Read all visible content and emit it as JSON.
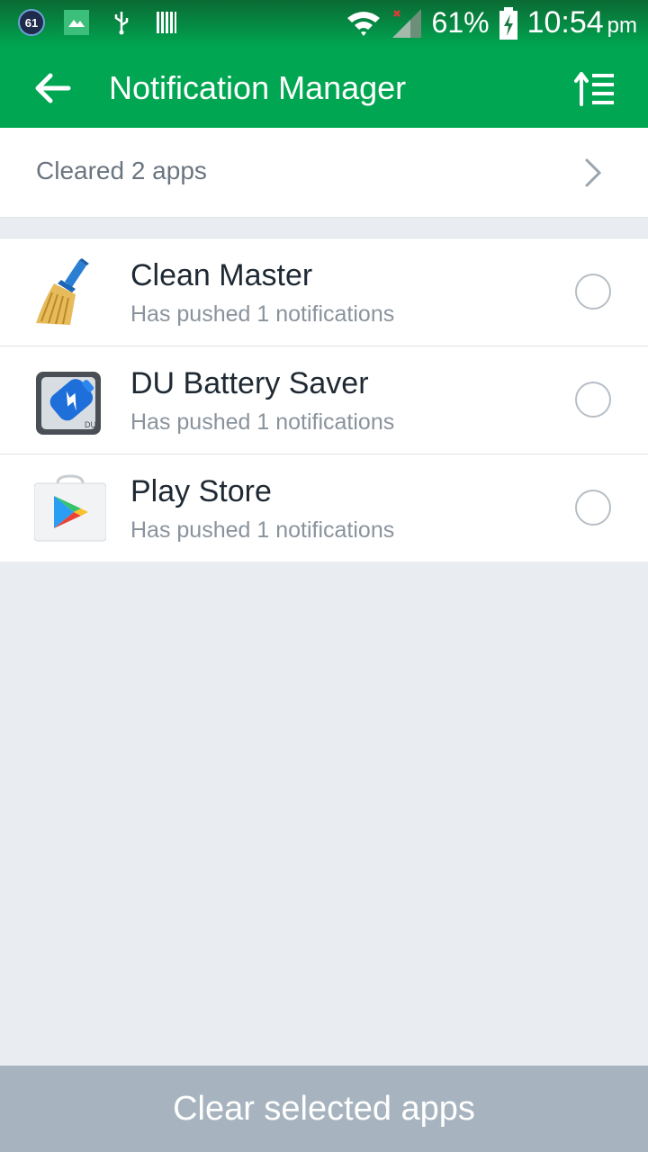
{
  "status_bar": {
    "notification_badge": "61",
    "battery_percent": "61%",
    "time": "10:54",
    "ampm": "pm",
    "icons": [
      "badge-icon",
      "photo-icon",
      "usb-icon",
      "barcode-icon",
      "wifi-icon",
      "signal-icon",
      "battery-charging-icon"
    ]
  },
  "app_bar": {
    "title": "Notification Manager",
    "back_icon": "arrow-left-icon",
    "sort_icon": "sort-list-icon",
    "color": "#00a651"
  },
  "cleared": {
    "label": "Cleared 2 apps",
    "icon": "chevron-right-icon"
  },
  "apps": [
    {
      "name": "Clean Master",
      "subtitle": "Has pushed 1 notifications",
      "icon": "broom-icon",
      "selected": false
    },
    {
      "name": "DU Battery Saver",
      "subtitle": "Has pushed 1 notifications",
      "icon": "battery-icon",
      "selected": false
    },
    {
      "name": "Play Store",
      "subtitle": "Has pushed 1 notifications",
      "icon": "play-store-icon",
      "selected": false
    }
  ],
  "footer": {
    "button_label": "Clear selected apps",
    "color": "#a7b4bf"
  }
}
